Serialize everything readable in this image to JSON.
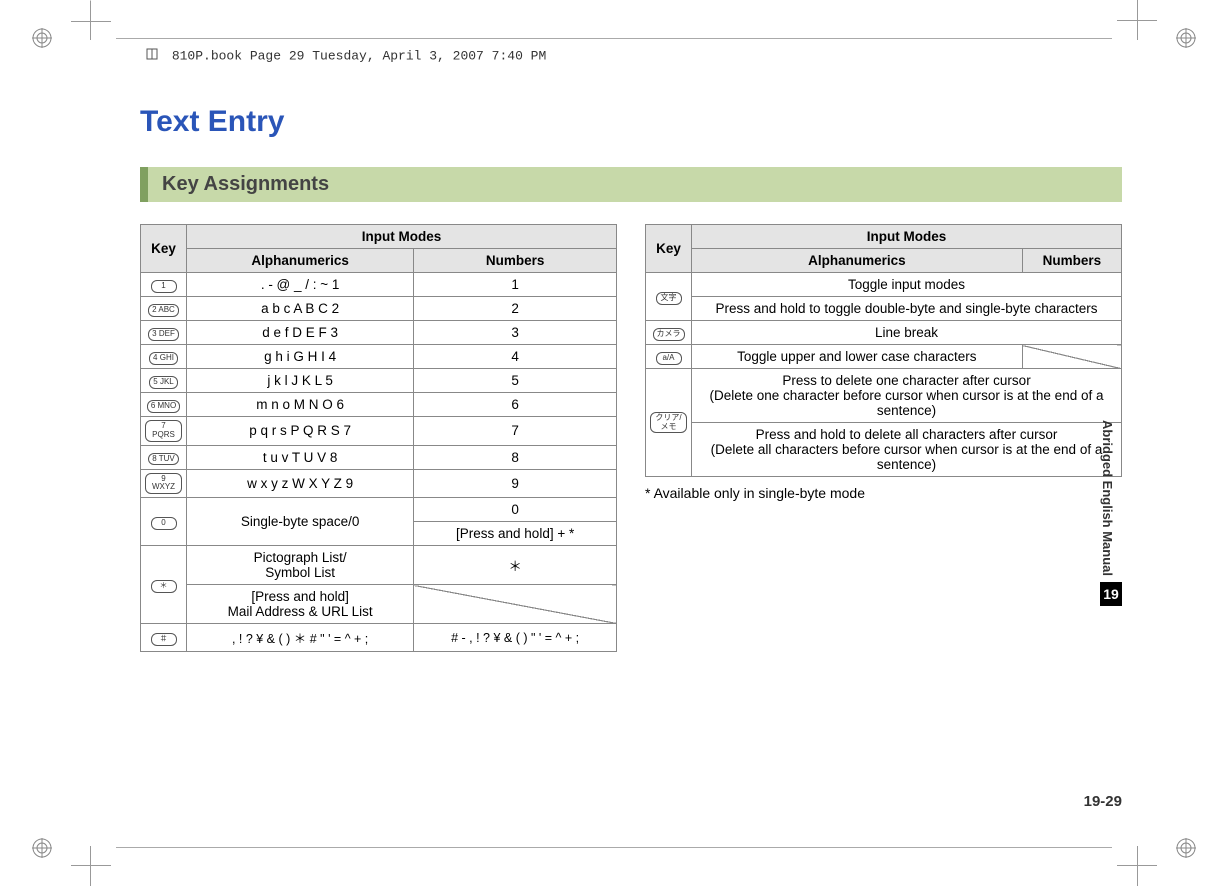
{
  "header_path": "810P.book  Page 29  Tuesday, April 3, 2007  7:40 PM",
  "title": "Text Entry",
  "subtitle": "Key Assignments",
  "left_table": {
    "head_key": "Key",
    "head_modes": "Input Modes",
    "head_alpha": "Alphanumerics",
    "head_num": "Numbers",
    "rows": [
      {
        "key": "1",
        "alpha": ". - @ _ / : ~ 1",
        "num": "1"
      },
      {
        "key": "2 ABC",
        "alpha": "a b c A B C 2",
        "num": "2"
      },
      {
        "key": "3 DEF",
        "alpha": "d e f D E F 3",
        "num": "3"
      },
      {
        "key": "4 GHI",
        "alpha": "g h i G H I 4",
        "num": "4"
      },
      {
        "key": "5 JKL",
        "alpha": "j k l J K L 5",
        "num": "5"
      },
      {
        "key": "6 MNO",
        "alpha": "m n o M N O 6",
        "num": "6"
      },
      {
        "key": "7 PQRS",
        "alpha": "p q r s P Q R S 7",
        "num": "7"
      },
      {
        "key": "8 TUV",
        "alpha": "t u v T U V 8",
        "num": "8"
      },
      {
        "key": "9 WXYZ",
        "alpha": "w x y z W X Y Z 9",
        "num": "9"
      }
    ],
    "row0": {
      "key": "0",
      "alpha": "Single-byte space/0",
      "num_a": "0",
      "num_b": "[Press and hold] + *"
    },
    "row_star": {
      "key": "＊",
      "alpha_a": "Pictograph List/\nSymbol List",
      "num_a": "＊",
      "alpha_b": "[Press and hold]\nMail Address & URL List"
    },
    "row_hash": {
      "key": "＃",
      "alpha": ", ! ? ¥ & ( ) ＊ # \" ' = ^ + ;",
      "num": "# - , ! ? ¥ & ( ) \" ' = ^ + ;"
    }
  },
  "right_table": {
    "head_key": "Key",
    "head_modes": "Input Modes",
    "head_alpha": "Alphanumerics",
    "head_num": "Numbers",
    "r1": {
      "key": "文字",
      "a": "Toggle input modes",
      "b": "Press and hold to toggle double-byte and single-byte characters"
    },
    "r2": {
      "key": "カメラ",
      "text": "Line break"
    },
    "r3": {
      "key": "a/A",
      "text": "Toggle upper and lower case characters"
    },
    "r4": {
      "key": "クリア/メモ",
      "a": "Press to delete one character after cursor\n(Delete one character before cursor when cursor is at the end of a sentence)",
      "b": "Press and hold to delete all characters after cursor\n(Delete all characters before cursor when cursor is at the end of a sentence)"
    }
  },
  "footnote": "* Available only in single-byte mode",
  "side_label": "Abridged English Manual",
  "chapter": "19",
  "page_number": "19-29"
}
